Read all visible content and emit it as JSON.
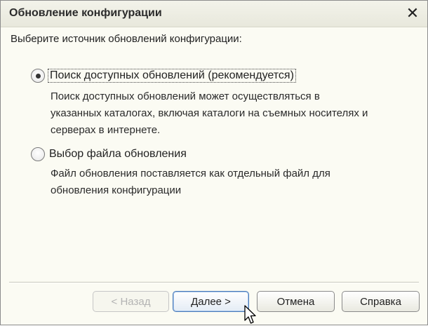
{
  "window": {
    "title": "Обновление конфигурации",
    "close_icon": "close-icon"
  },
  "prompt": "Выберите источник обновлений конфигурации:",
  "options": [
    {
      "label": "Поиск доступных обновлений (рекомендуется)",
      "selected": true,
      "description_lines": [
        "Поиск доступных обновлений может осуществляться в",
        "указанных каталогах, включая каталоги на съемных носителях и",
        "серверах в интернете."
      ]
    },
    {
      "label": "Выбор файла обновления",
      "selected": false,
      "description_lines": [
        "Файл обновления поставляется как отдельный файл для",
        "обновления конфигурации"
      ]
    }
  ],
  "buttons": {
    "back": {
      "label": "< Назад",
      "enabled": false
    },
    "next": {
      "label": "Далее >",
      "enabled": true
    },
    "cancel": {
      "label": "Отмена",
      "enabled": true
    },
    "help": {
      "label": "Справка",
      "enabled": true
    }
  }
}
